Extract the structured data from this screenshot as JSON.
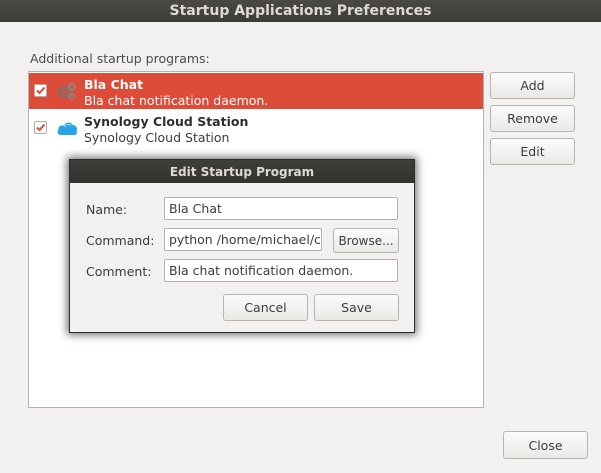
{
  "window": {
    "title": "Startup Applications Preferences"
  },
  "main": {
    "list_label": "Additional startup programs:",
    "programs": [
      {
        "name": "Bla Chat",
        "description": "Bla chat notification daemon.",
        "enabled": true,
        "selected": true,
        "icon": "gears-icon"
      },
      {
        "name": "Synology Cloud Station",
        "description": "Synology Cloud Station",
        "enabled": true,
        "selected": false,
        "icon": "cloud-icon"
      }
    ],
    "buttons": {
      "add": "Add",
      "remove": "Remove",
      "edit": "Edit",
      "close": "Close"
    }
  },
  "dialog": {
    "title": "Edit Startup Program",
    "name_label": "Name:",
    "name_value": "Bla Chat",
    "command_label": "Command:",
    "command_value": "python /home/michael/cl",
    "browse": "Browse...",
    "comment_label": "Comment:",
    "comment_value": "Bla chat notification daemon.",
    "cancel": "Cancel",
    "save": "Save"
  },
  "colors": {
    "selection": "#dd4b39",
    "titlebar": "#3c3b37",
    "background": "#f2f1f0",
    "cloud": "#29a3e6"
  }
}
